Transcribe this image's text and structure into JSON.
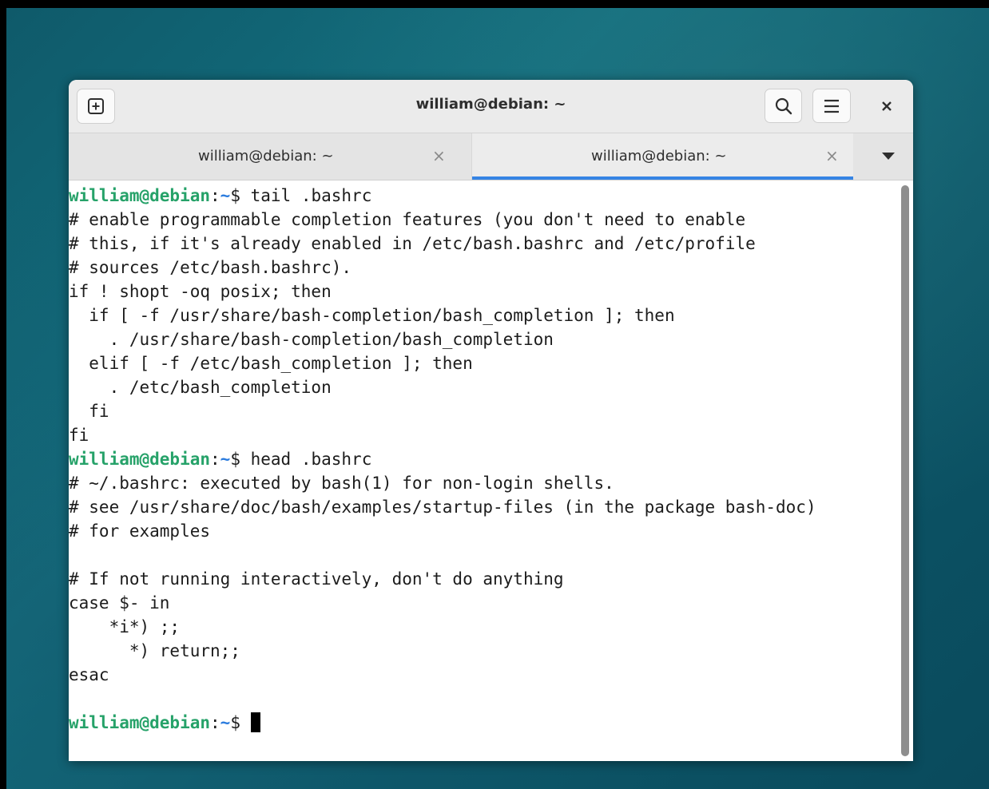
{
  "window": {
    "title": "william@debian: ~"
  },
  "tabs": [
    {
      "label": "william@debian: ~",
      "close": "×",
      "active": false
    },
    {
      "label": "william@debian: ~",
      "close": "×",
      "active": true
    }
  ],
  "terminal": {
    "prompt": {
      "user": "william@debian",
      "sep": ":",
      "path": "~",
      "symbol": "$ "
    },
    "cmd1": "tail .bashrc",
    "out1": [
      "# enable programmable completion features (you don't need to enable",
      "# this, if it's already enabled in /etc/bash.bashrc and /etc/profile",
      "# sources /etc/bash.bashrc).",
      "if ! shopt -oq posix; then",
      "  if [ -f /usr/share/bash-completion/bash_completion ]; then",
      "    . /usr/share/bash-completion/bash_completion",
      "  elif [ -f /etc/bash_completion ]; then",
      "    . /etc/bash_completion",
      "  fi",
      "fi"
    ],
    "cmd2": "head .bashrc",
    "out2": [
      "# ~/.bashrc: executed by bash(1) for non-login shells.",
      "# see /usr/share/doc/bash/examples/startup-files (in the package bash-doc)",
      "# for examples",
      "",
      "# If not running interactively, don't do anything",
      "case $- in",
      "    *i*) ;;",
      "      *) return;;",
      "esac",
      ""
    ]
  },
  "icons": {
    "new_tab": "new-tab-icon",
    "search": "search-icon",
    "menu": "hamburger-menu-icon",
    "close": "close-icon",
    "dropdown": "chevron-down-icon"
  },
  "colors": {
    "prompt_user": "#26a269",
    "prompt_path": "#2a7bde",
    "active_tab_indicator": "#3584e4"
  }
}
